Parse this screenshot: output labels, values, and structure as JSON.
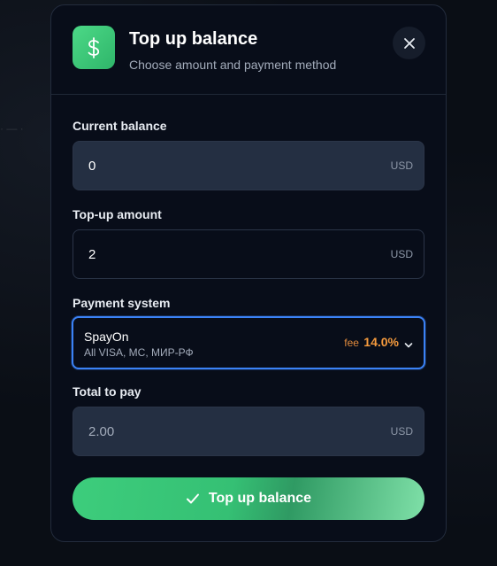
{
  "background": {
    "ghost_text": "· — ·"
  },
  "modal": {
    "title": "Top up balance",
    "subtitle": "Choose amount and payment method",
    "header_icon": "dollar-icon",
    "close_icon": "close-icon"
  },
  "form": {
    "current_balance": {
      "label": "Current balance",
      "value": "0",
      "unit": "USD"
    },
    "topup_amount": {
      "label": "Top-up amount",
      "value": "2",
      "unit": "USD"
    },
    "payment_system": {
      "label": "Payment system",
      "selected_name": "SpayOn",
      "selected_description": "All VISA, MC, МИР-РФ",
      "fee_label": "fee",
      "fee_value": "14.0%",
      "chevron_icon": "chevron-down-icon"
    },
    "total": {
      "label": "Total to pay",
      "value": "2.00",
      "unit": "USD"
    },
    "submit": {
      "label": "Top up balance",
      "icon": "check-icon"
    }
  },
  "colors": {
    "accent_green": "#3dcd7c",
    "focus_blue": "#3b82f6",
    "fee_orange": "#f59a3d",
    "modal_bg": "#080d19"
  }
}
